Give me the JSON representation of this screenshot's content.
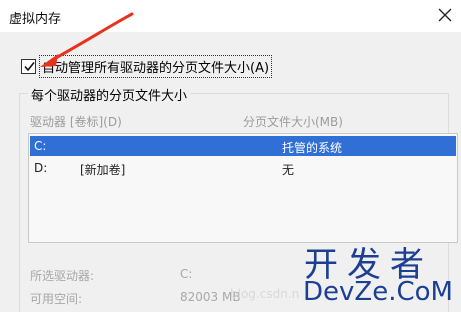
{
  "window": {
    "title": "虚拟内存",
    "close_icon": "close-icon"
  },
  "auto_manage": {
    "checked": true,
    "label": "自动管理所有驱动器的分页文件大小(A)"
  },
  "group": {
    "title": "每个驱动器的分页文件大小"
  },
  "drive_list": {
    "columns": [
      "驱动器 [卷标](D)",
      "分页文件大小(MB)"
    ],
    "rows": [
      {
        "drive": "C:",
        "label": "",
        "size": "托管的系统",
        "selected": true
      },
      {
        "drive": "D:",
        "label": "[新加卷]",
        "size": "无",
        "selected": false
      }
    ]
  },
  "details": {
    "selected_drive_label": "所选驱动器:",
    "selected_drive_value": "C:",
    "free_space_label": "可用空间:",
    "free_space_value": "82003 MB"
  },
  "watermark": {
    "cn": "开发者",
    "en": "DevZe.CoM",
    "csdn": "blog.csdn.n"
  },
  "colors": {
    "selection": "#2f6fd6",
    "arrow": "#e8321e",
    "dialog_bg": "#f0f0f0",
    "watermark": "#1c3f94"
  }
}
